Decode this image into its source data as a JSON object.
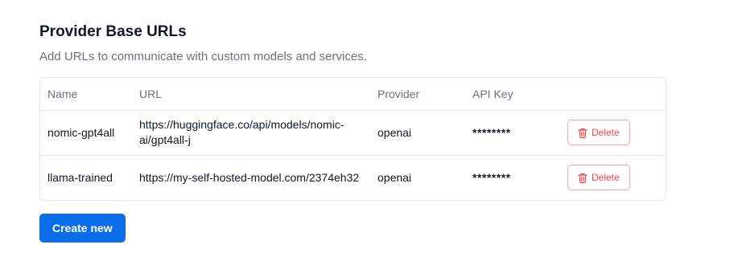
{
  "section": {
    "title": "Provider Base URLs",
    "subtitle": "Add URLs to communicate with custom models and services."
  },
  "table": {
    "headers": {
      "name": "Name",
      "url": "URL",
      "provider": "Provider",
      "api_key": "API Key"
    },
    "rows": [
      {
        "name": "nomic-gpt4all",
        "url": "https://huggingface.co/api/models/nomic-ai/gpt4all-j",
        "provider": "openai",
        "api_key": "********",
        "delete_label": "Delete"
      },
      {
        "name": "llama-trained",
        "url": "https://my-self-hosted-model.com/2374eh32",
        "provider": "openai",
        "api_key": "********",
        "delete_label": "Delete"
      }
    ]
  },
  "actions": {
    "create_label": "Create new"
  },
  "colors": {
    "primary": "#0b6ee8",
    "danger": "#ef4444",
    "danger_border": "#fca5a5",
    "muted_text": "#6b7280",
    "border": "#e5e7eb"
  },
  "icons": {
    "delete": "trash-icon"
  }
}
